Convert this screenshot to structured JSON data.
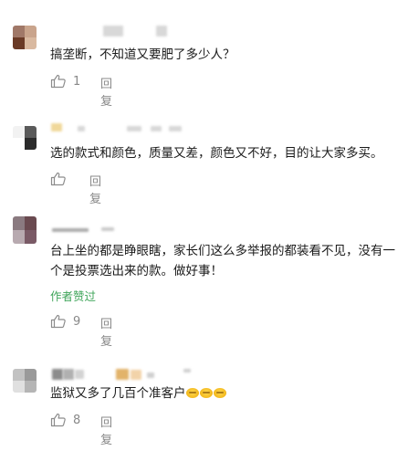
{
  "comments": [
    {
      "text": "搞垄断，不知道又要肥了多少人？",
      "like_count": "1",
      "reply_label": "回复",
      "author_tag": ""
    },
    {
      "text": "选的款式和颜色，质量又差，颜色又不好，目的让大家多买。",
      "like_count": "",
      "reply_label": "回复",
      "author_tag": ""
    },
    {
      "text": "台上坐的都是睁眼瞎，家长们这么多举报的都装看不见，没有一个是投票选出来的款。做好事！",
      "like_count": "9",
      "reply_label": "回复",
      "author_tag": "作者赞过"
    },
    {
      "text": "监狱又多了几百个准客户",
      "like_count": "8",
      "reply_label": "回复",
      "author_tag": ""
    }
  ],
  "icons": {
    "like": "thumbs-up-icon",
    "emoji": "laughing-emoji-icon"
  },
  "colors": {
    "text": "#1a1a1a",
    "secondary": "#888888",
    "author_tag": "#3fa55a"
  }
}
